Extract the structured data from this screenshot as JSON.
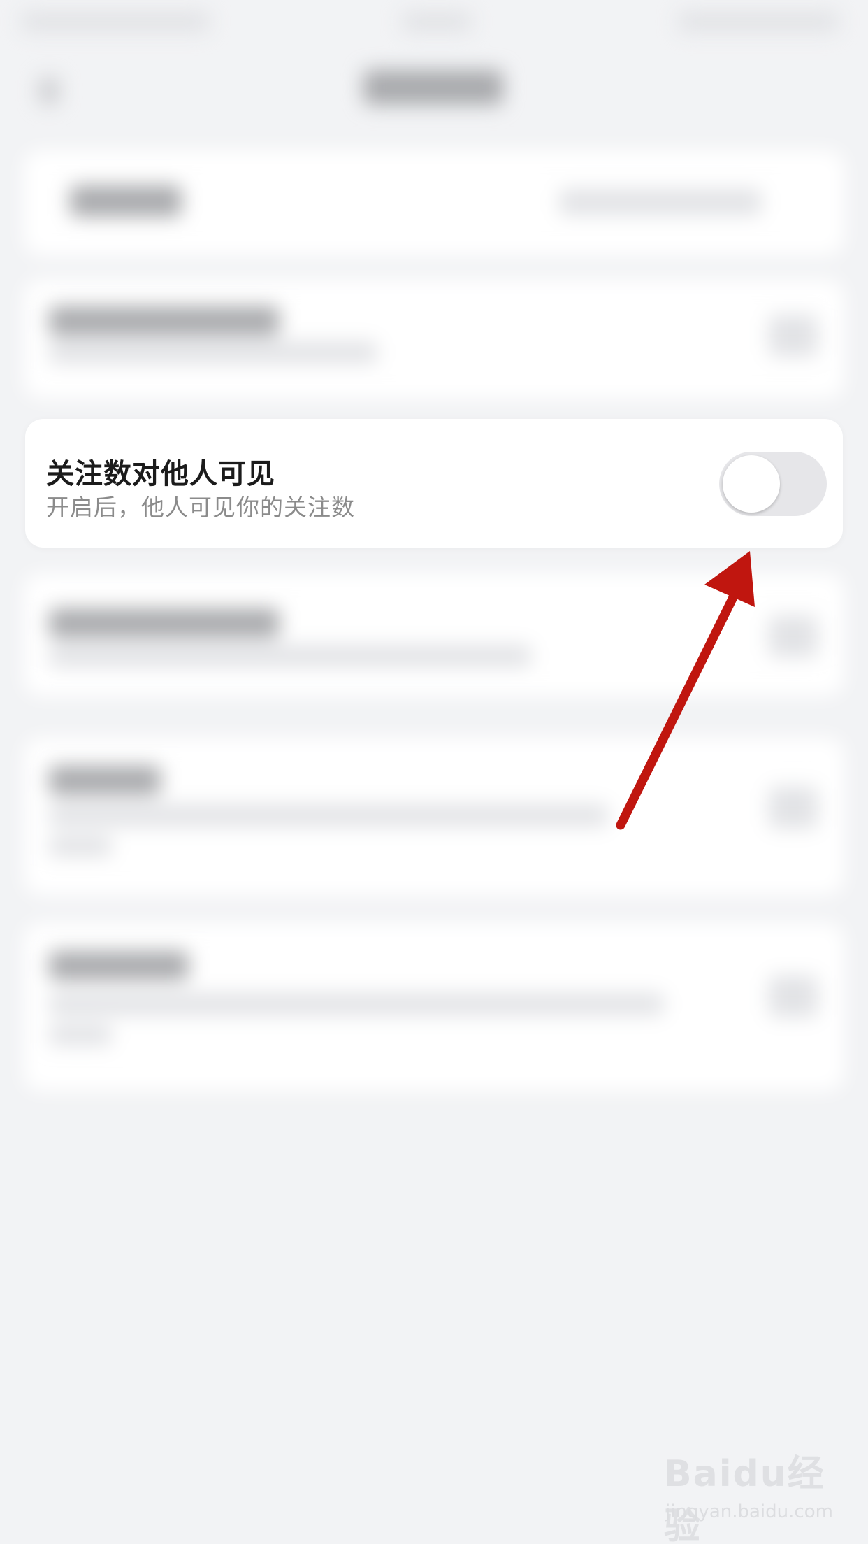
{
  "setting": {
    "title": "关注数对他人可见",
    "description": "开启后，他人可见你的关注数",
    "toggle_enabled": false
  },
  "colors": {
    "background": "#f2f3f5",
    "card": "#ffffff",
    "title_text": "#1b1b1b",
    "description_text": "#8b8b8b",
    "toggle_off_track": "#e6e6e9",
    "annotation_arrow": "#c0160f"
  },
  "watermark": {
    "logo": "Baidu经验",
    "url": "jingyan.baidu.com"
  }
}
